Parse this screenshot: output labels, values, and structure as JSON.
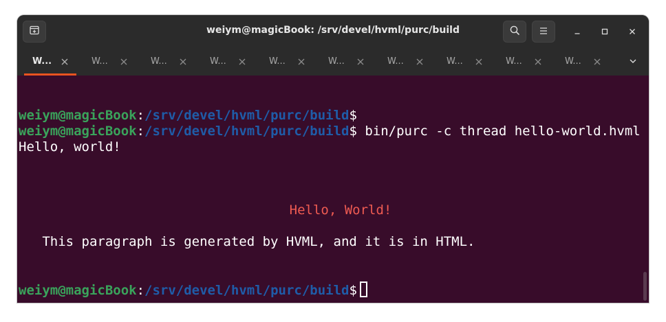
{
  "window": {
    "title": "weiym@magicBook: /srv/devel/hvml/purc/build"
  },
  "headerbar": {
    "new_tab_icon": "new-tab-icon",
    "search_icon": "search-icon",
    "menu_icon": "hamburger-menu-icon",
    "minimize_icon": "minimize-icon",
    "maximize_icon": "maximize-icon",
    "close_icon": "close-icon"
  },
  "tabs": [
    {
      "label": "W...",
      "active": true
    },
    {
      "label": "W...",
      "active": false
    },
    {
      "label": "W...",
      "active": false
    },
    {
      "label": "W...",
      "active": false
    },
    {
      "label": "W...",
      "active": false
    },
    {
      "label": "W...",
      "active": false
    },
    {
      "label": "W...",
      "active": false
    },
    {
      "label": "W...",
      "active": false
    },
    {
      "label": "W...",
      "active": false
    },
    {
      "label": "W...",
      "active": false
    }
  ],
  "terminal": {
    "colors": {
      "background": "#380c2a",
      "user": "#3aa35b",
      "path": "#1f5ca8",
      "text": "#ffffff",
      "heading": "#ef5b52"
    },
    "prompt_user": "weiym@magicBook",
    "prompt_sep": ":",
    "prompt_path": "/srv/devel/hvml/purc/build",
    "prompt_symbol": "$",
    "command": " bin/purc -c thread hello-world.hvml",
    "output_1": "Hello, world!",
    "heading": "Hello, World!",
    "paragraph": "   This paragraph is generated by HVML, and it is in HTML."
  }
}
